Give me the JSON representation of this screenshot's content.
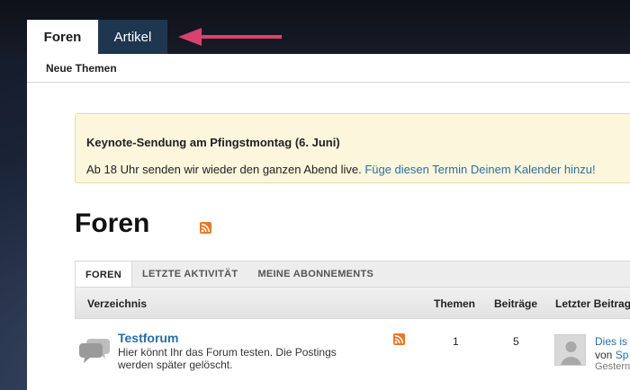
{
  "tabs": {
    "foren": "Foren",
    "artikel": "Artikel"
  },
  "subnav": {
    "neue_themen": "Neue Themen"
  },
  "notice": {
    "title": "Keynote-Sendung am Pfingstmontag (6. Juni)",
    "body": "Ab 18 Uhr senden wir wieder den ganzen Abend live. ",
    "link": "Füge diesen Termin Deinem Kalender hinzu!"
  },
  "page_title": "Foren",
  "subtabs": [
    "FOREN",
    "LETZTE AKTIVITÄT",
    "MEINE ABONNEMENTS"
  ],
  "table": {
    "headers": {
      "verzeichnis": "Verzeichnis",
      "themen": "Themen",
      "beitraege": "Beiträge",
      "letzter": "Letzter Beitrag"
    },
    "rows": [
      {
        "title": "Testforum",
        "description": "Hier könnt Ihr das Forum testen. Die Postings werden später gelöscht.",
        "themen": "1",
        "beitraege": "5",
        "last_title": "Dies is",
        "last_by_prefix": "von ",
        "last_by": "Sp",
        "last_time": "Gestern"
      }
    ]
  },
  "colors": {
    "link": "#2a6ea6",
    "rss": "#e8782a",
    "arrow": "#d8426e",
    "active_tab_dark": "#1e3650"
  },
  "icons": {
    "rss": "rss-icon",
    "bubble": "speech-bubble-icon",
    "avatar": "avatar-icon",
    "arrow": "pointer-arrow"
  }
}
